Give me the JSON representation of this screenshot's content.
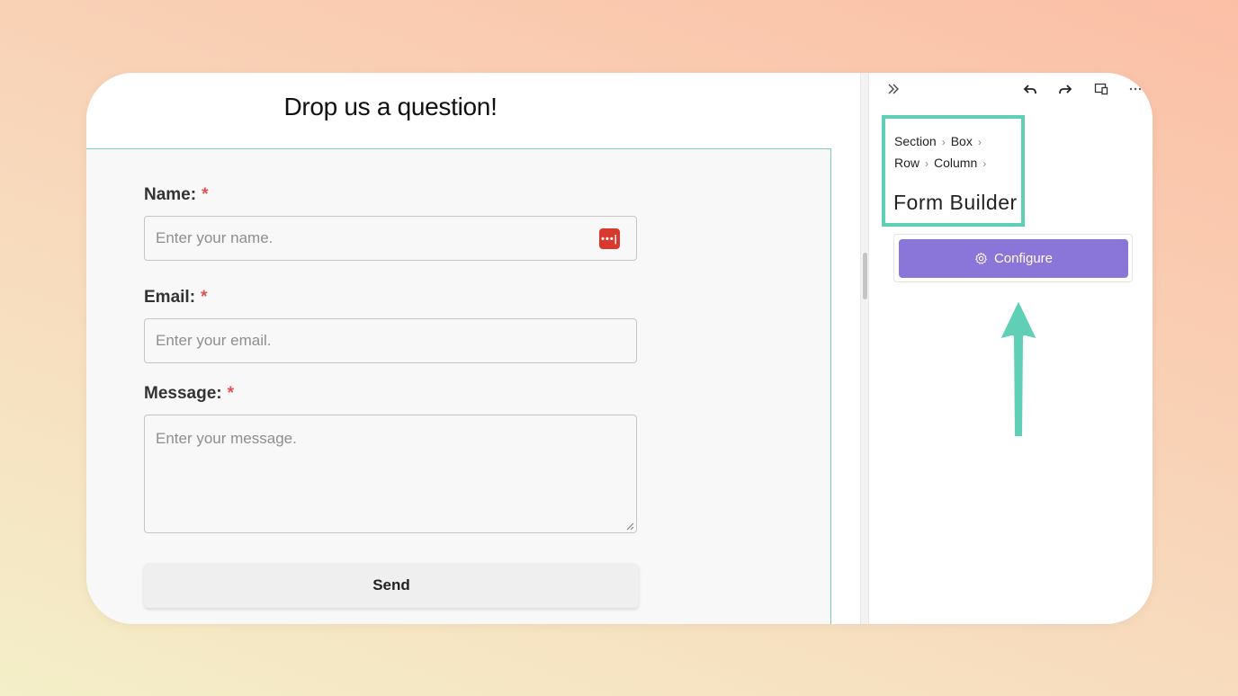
{
  "form": {
    "heading": "Drop us a question!",
    "required_mark": "*",
    "fields": [
      {
        "label": "Name:",
        "placeholder": "Enter your name."
      },
      {
        "label": "Email:",
        "placeholder": "Enter your email."
      },
      {
        "label": "Message:",
        "placeholder": "Enter your message."
      }
    ],
    "submit_label": "Send"
  },
  "panel": {
    "breadcrumb_line1": [
      "Section",
      "Box"
    ],
    "breadcrumb_line2": [
      "Row",
      "Column"
    ],
    "separator": "›",
    "title": "Form Builder",
    "configure_label": "Configure",
    "toolbar_icons": [
      "expand-icon",
      "undo-icon",
      "redo-icon",
      "responsive-preview-icon",
      "more-icon"
    ]
  },
  "colors": {
    "accent_purple": "#8a75d8",
    "highlight_teal": "#5fd0b5",
    "required_red": "#e05252",
    "password_icon_red": "#d9382f"
  }
}
